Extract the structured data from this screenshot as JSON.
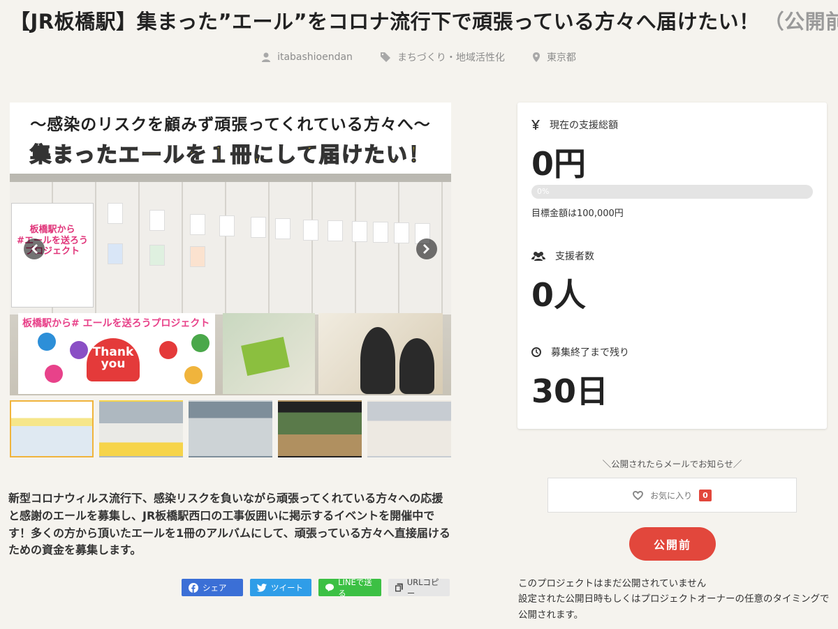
{
  "project": {
    "title": "【JR板橋駅】集まった”エール”をコロナ流行下で頑張っている方々へ届けたい！",
    "title_suffix": "（公開前）",
    "owner": "itabashioendan",
    "category": "まちづくり・地域活性化",
    "location": "東京都",
    "description": "新型コロナウィルス流行下、感染リスクを負いながら頑張ってくれている方々への応援と感謝のエールを募集し、JR板橋駅西口の工事仮囲いに掲示するイベントを開催中です！多くの方から頂いたエールを1冊のアルバムにして、頑張っている方々へ直接届けるための資金を募集します。"
  },
  "hero": {
    "line1": "〜感染のリスクを顧みず頑張ってくれている方々へ〜",
    "line2": "集まったエールを１冊にして届けたい！",
    "poster_text": "板橋駅から\n#エールを送ろう\nプロジェクト",
    "lower_title": "板橋駅から# エールを送ろうプロジェクト",
    "thank_you": "Thank you"
  },
  "thumbnails": [
    {
      "id": "t1",
      "active": true
    },
    {
      "id": "t2",
      "active": false
    },
    {
      "id": "t3",
      "active": false
    },
    {
      "id": "t4",
      "active": false
    },
    {
      "id": "t5",
      "active": false
    }
  ],
  "share": {
    "facebook": "シェア",
    "twitter": "ツイート",
    "line": "LINEで送る",
    "copy": "URLコピー"
  },
  "stats": {
    "total_label": "現在の支援総額",
    "total_value": "0円",
    "progress_text": "0%",
    "progress_fraction": 0,
    "goal_text": "目標金額は100,000円",
    "backers_label": "支援者数",
    "backers_value": "0人",
    "remaining_label": "募集終了まで残り",
    "remaining_value": "30日"
  },
  "actions": {
    "notify_text": "＼公開されたらメールでお知らせ／",
    "favorite_label": "お気に入り",
    "favorite_count": "0",
    "publish_label": "公開前",
    "status_line1": "このプロジェクトはまだ公開されていません",
    "status_line2": "設定された公開日時もしくはプロジェクトオーナーの任意のタイミングで公開されます。"
  },
  "icons": {
    "owner": "user-icon",
    "category": "tag-icon",
    "location": "map-pin-icon",
    "yen": "yen-icon",
    "backers": "users-icon",
    "clock": "clock-icon",
    "heart": "heart-icon"
  },
  "colors": {
    "accent_red": "#e2473c",
    "facebook": "#3b6fd6",
    "twitter": "#2f9de8",
    "line": "#3cc044",
    "active_thumb": "#f0b43c"
  }
}
